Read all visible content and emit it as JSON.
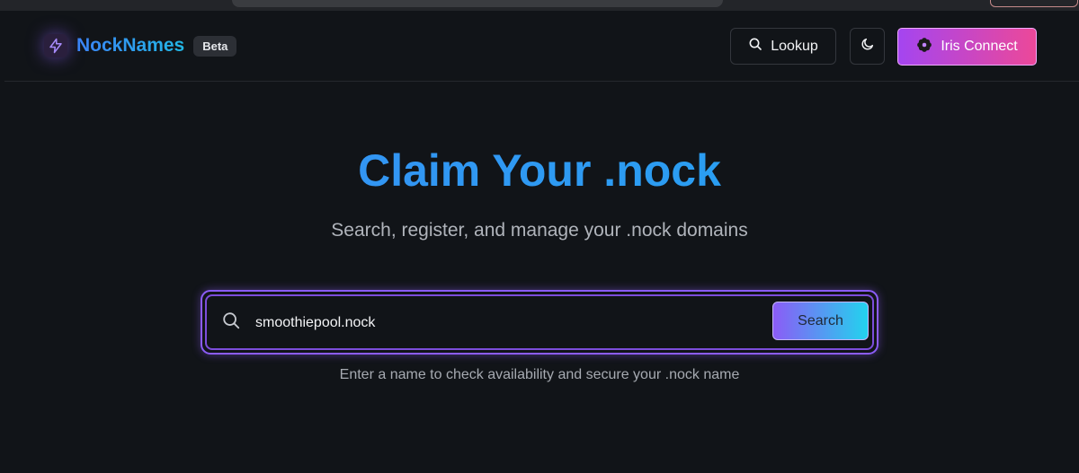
{
  "header": {
    "brand_name": "NockNames",
    "badge": "Beta",
    "lookup_label": "Lookup",
    "connect_label": "Iris Connect"
  },
  "hero": {
    "title": "Claim Your .nock",
    "subtitle": "Search, register, and manage your .nock domains"
  },
  "search": {
    "value": "smoothiepool.nock",
    "button_label": "Search",
    "hint": "Enter a name to check availability and secure your .nock name"
  },
  "icons": {
    "brand": "lightning-bolt-icon",
    "lookup": "search-icon",
    "theme": "moon-icon",
    "connect": "iris-flower-icon",
    "search_field": "search-icon"
  },
  "colors": {
    "background": "#111418",
    "brand_gradient_start": "#3b82f6",
    "brand_gradient_end": "#22b8e6",
    "accent_purple": "#8b5cf6",
    "connect_gradient_start": "#a445f0",
    "connect_gradient_end": "#ec4899",
    "search_button_gradient_end": "#22d3ee"
  }
}
